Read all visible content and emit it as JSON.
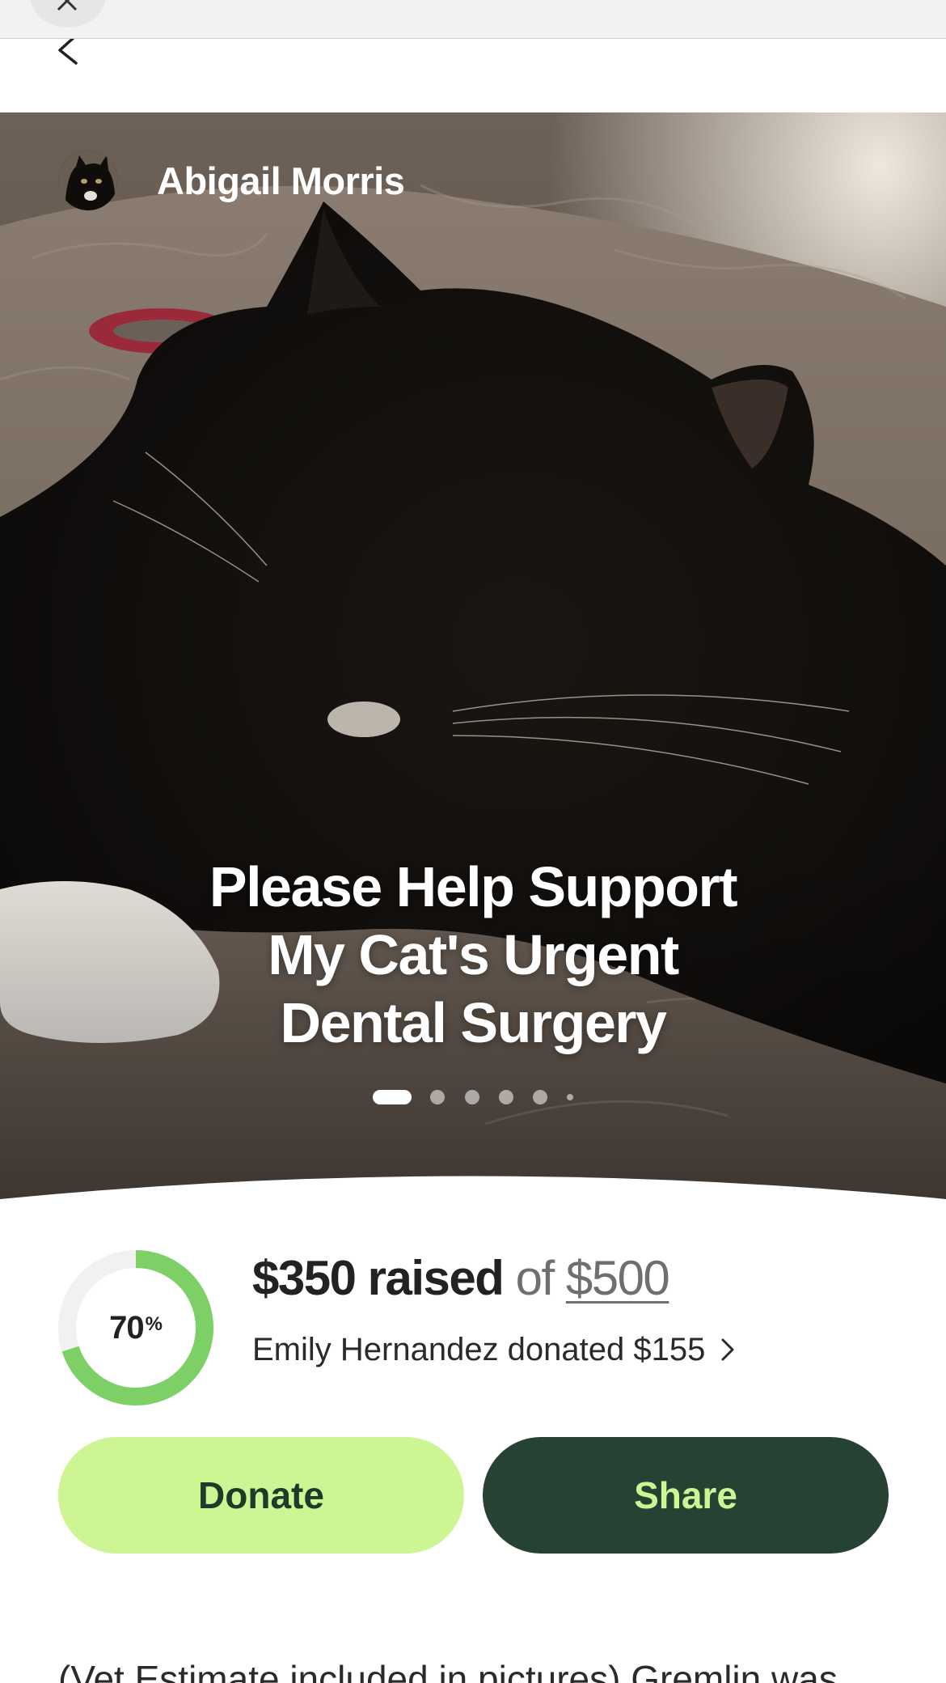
{
  "organizer": {
    "name": "Abigail Morris"
  },
  "campaign": {
    "title_lines": [
      "Please Help Support",
      "My Cat's Urgent",
      "Dental Surgery"
    ],
    "carousel_slides": 6,
    "carousel_active_index": 0
  },
  "progress": {
    "percent_number": "70",
    "percent_sign": "%",
    "fraction": 0.7,
    "raised_text": "$350 raised",
    "of_text": "of",
    "goal_text": "$500",
    "recent_donation": "Emily Hernandez donated $155"
  },
  "actions": {
    "donate_label": "Donate",
    "share_label": "Share"
  },
  "story": {
    "preview": "(Vet Estimate included in pictures) Gremlin was"
  },
  "colors": {
    "accent_light": "#cdf594",
    "accent_dark": "#254232",
    "progress_green": "#7dd065",
    "track": "#f1f1f1"
  },
  "icons": {
    "close": "close-icon",
    "back": "chevron-left-icon",
    "donation_arrow": "chevron-right-icon"
  }
}
